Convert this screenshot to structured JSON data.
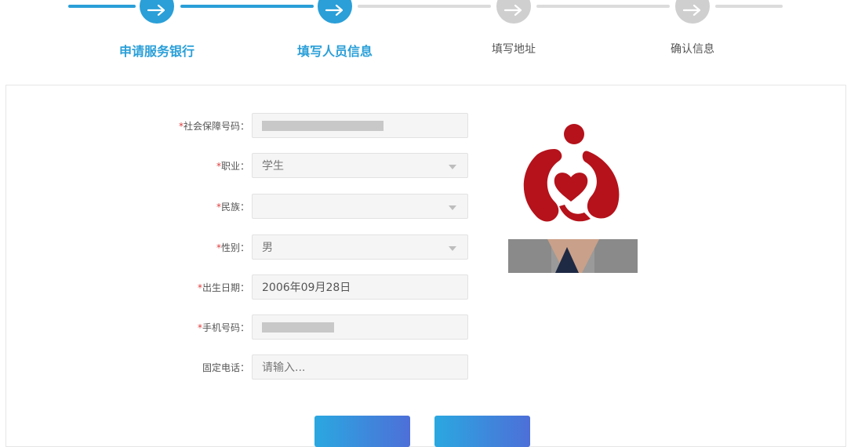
{
  "steps": [
    {
      "label": "申请服务银行",
      "state": "done"
    },
    {
      "label": "填写人员信息",
      "state": "active"
    },
    {
      "label": "填写地址",
      "state": "todo"
    },
    {
      "label": "确认信息",
      "state": "todo"
    }
  ],
  "form": {
    "social_security": {
      "label": "*社会保障号码：",
      "value": ""
    },
    "occupation": {
      "label": "*职业：",
      "value": "学生"
    },
    "ethnicity": {
      "label": "*民族：",
      "value": ""
    },
    "gender": {
      "label": "*性别：",
      "value": "男"
    },
    "birthdate": {
      "label": "*出生日期：",
      "value": "2006年09月28日"
    },
    "mobile": {
      "label": "*手机号码：",
      "value": ""
    },
    "landline": {
      "label": "固定电话：",
      "placeholder": "请输入..."
    }
  },
  "colors": {
    "accent": "#2a9fd8",
    "required": "#e03c3c",
    "logo": "#b5121b"
  },
  "icons": {
    "step": "arrow-right-icon",
    "select": "chevron-down-icon"
  }
}
